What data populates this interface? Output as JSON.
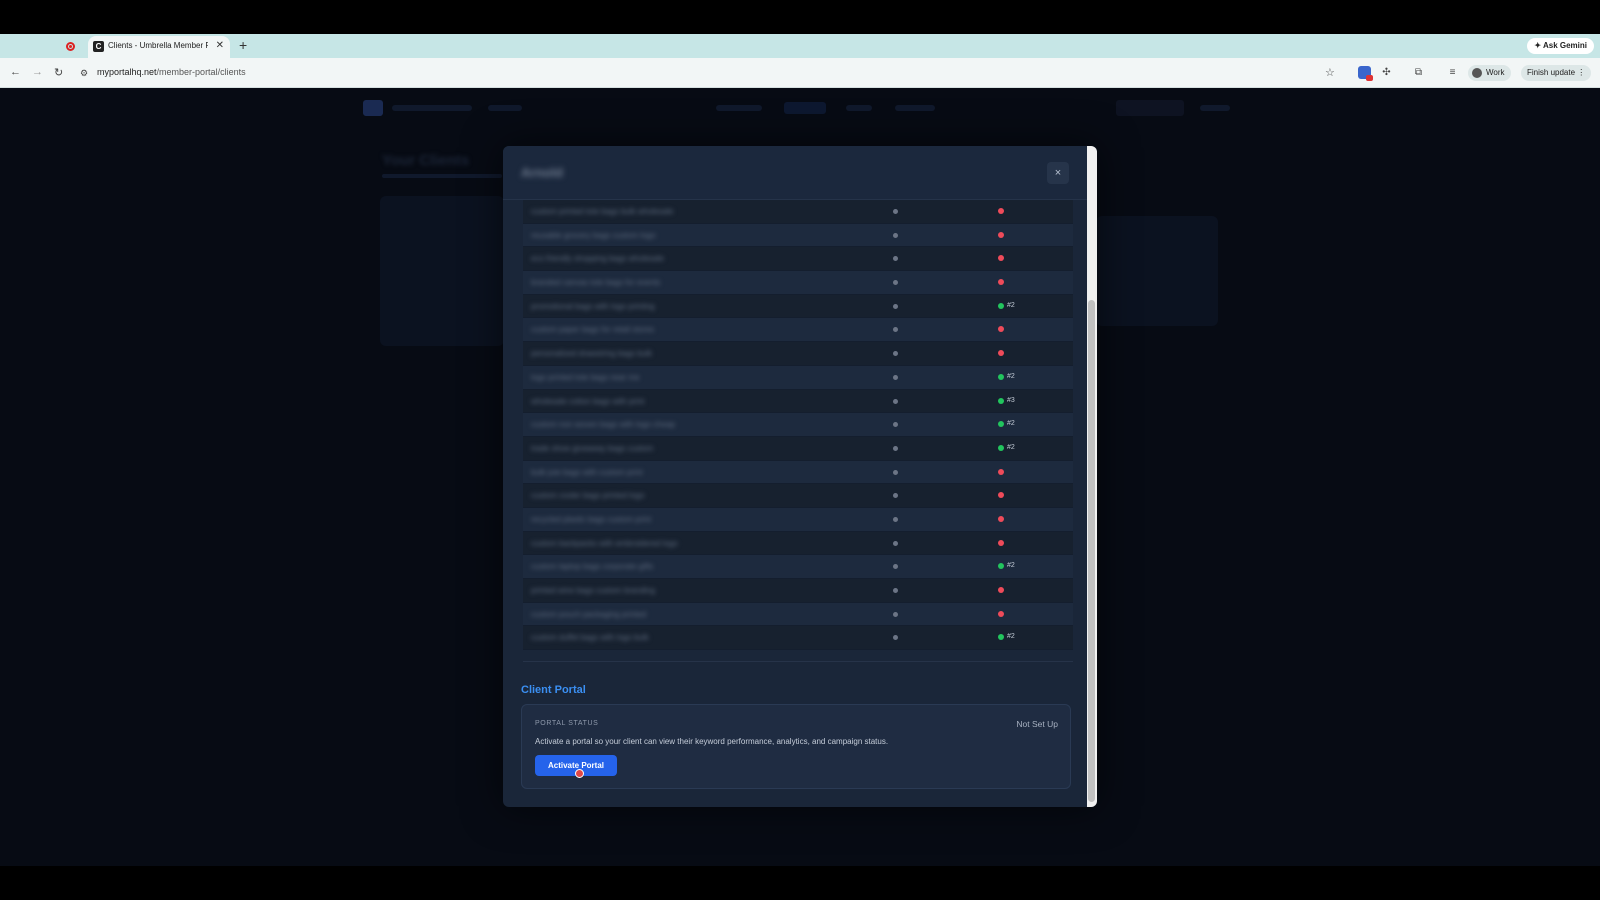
{
  "browser": {
    "tab_title": "Clients - Umbrella Member P",
    "tab_favicon": "C",
    "url_domain": "myportalhq.net",
    "url_path": "/member-portal/clients",
    "ask_gemini": "Ask Gemini",
    "profile_label": "Work",
    "finish_update": "Finish update"
  },
  "page": {
    "ghost_title": "Your Clients"
  },
  "modal": {
    "title": "Arnold",
    "close": "×",
    "keywords": [
      {
        "name": "custom printed tote bags bulk wholesale",
        "status": "red",
        "rank": ""
      },
      {
        "name": "reusable grocery bags custom logo",
        "status": "red",
        "rank": ""
      },
      {
        "name": "eco friendly shopping bags wholesale",
        "status": "red",
        "rank": ""
      },
      {
        "name": "branded canvas tote bags for events",
        "status": "red",
        "rank": ""
      },
      {
        "name": "promotional bags with logo printing",
        "status": "green",
        "rank": "#2"
      },
      {
        "name": "custom paper bags for retail stores",
        "status": "red",
        "rank": ""
      },
      {
        "name": "personalized drawstring bags bulk",
        "status": "red",
        "rank": ""
      },
      {
        "name": "logo printed tote bags near me",
        "status": "green",
        "rank": "#2"
      },
      {
        "name": "wholesale cotton bags with print",
        "status": "green",
        "rank": "#3"
      },
      {
        "name": "custom non woven bags with logo cheap",
        "status": "green",
        "rank": "#2"
      },
      {
        "name": "trade show giveaway bags custom",
        "status": "green",
        "rank": "#2"
      },
      {
        "name": "bulk jute bags with custom print",
        "status": "red",
        "rank": ""
      },
      {
        "name": "custom cooler bags printed logo",
        "status": "red",
        "rank": ""
      },
      {
        "name": "recycled plastic bags custom print",
        "status": "red",
        "rank": ""
      },
      {
        "name": "custom backpacks with embroidered logo",
        "status": "red",
        "rank": ""
      },
      {
        "name": "custom laptop bags corporate gifts",
        "status": "green",
        "rank": "#2"
      },
      {
        "name": "printed wine bags custom branding",
        "status": "red",
        "rank": ""
      },
      {
        "name": "custom pouch packaging printed",
        "status": "red",
        "rank": ""
      },
      {
        "name": "custom duffel bags with logo bulk",
        "status": "green",
        "rank": "#2"
      }
    ]
  },
  "portal": {
    "section_title": "Client Portal",
    "label": "PORTAL STATUS",
    "status": "Not Set Up",
    "description": "Activate a portal so your client can view their keyword performance, analytics, and campaign status.",
    "button": "Activate Portal"
  },
  "colors": {
    "accent": "#2563eb",
    "status_red": "#ef4b5a",
    "status_green": "#22c55e",
    "section_title": "#3b8ff2"
  }
}
